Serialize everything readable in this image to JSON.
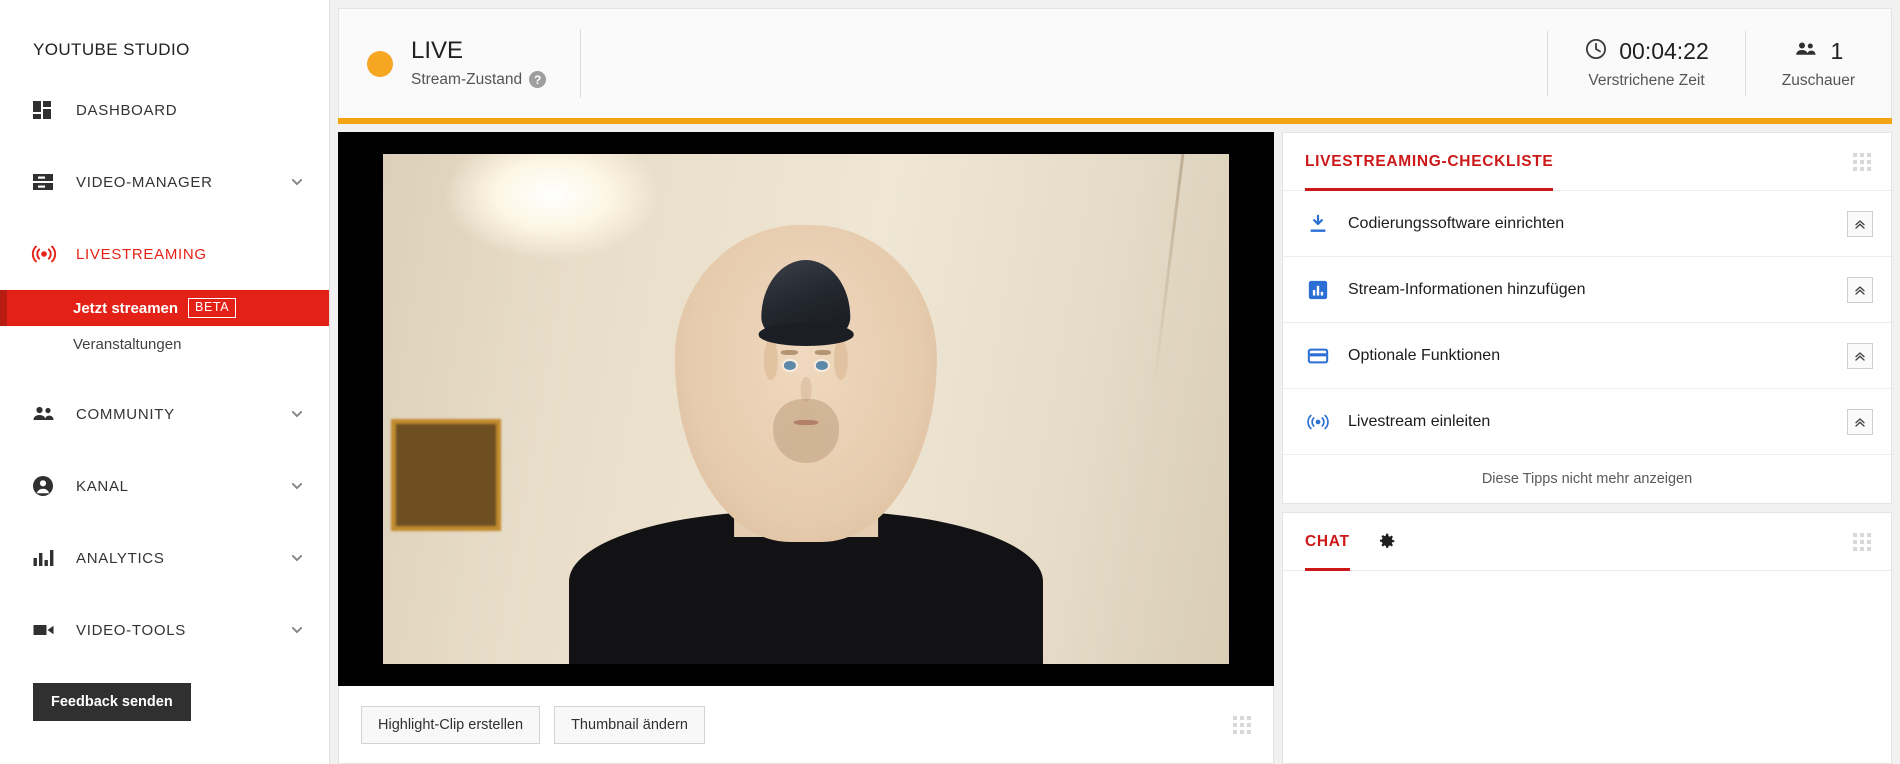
{
  "sidebar": {
    "brand": "YOUTUBE STUDIO",
    "items": [
      {
        "label": "DASHBOARD",
        "icon": "dashboard-icon",
        "expandable": false,
        "active": false
      },
      {
        "label": "VIDEO-MANAGER",
        "icon": "video-manager-icon",
        "expandable": true,
        "active": false
      },
      {
        "label": "LIVESTREAMING",
        "icon": "livestream-icon",
        "expandable": false,
        "active": true
      },
      {
        "label": "COMMUNITY",
        "icon": "community-icon",
        "expandable": true,
        "active": false
      },
      {
        "label": "KANAL",
        "icon": "channel-icon",
        "expandable": true,
        "active": false
      },
      {
        "label": "ANALYTICS",
        "icon": "analytics-icon",
        "expandable": true,
        "active": false
      },
      {
        "label": "VIDEO-TOOLS",
        "icon": "video-tools-icon",
        "expandable": true,
        "active": false
      }
    ],
    "sub_items": [
      {
        "label": "Jetzt streamen",
        "badge": "BETA",
        "selected": true
      },
      {
        "label": "Veranstaltungen",
        "badge": "",
        "selected": false
      }
    ],
    "feedback_button": "Feedback senden"
  },
  "header": {
    "status_title": "LIVE",
    "status_subtitle": "Stream-Zustand",
    "help_glyph": "?",
    "status_dot_color": "#f5a623",
    "accent_bar_color": "#f2a413",
    "metrics": [
      {
        "icon": "clock-icon",
        "value": "00:04:22",
        "label": "Verstrichene Zeit"
      },
      {
        "icon": "viewers-icon",
        "value": "1",
        "label": "Zuschauer"
      }
    ]
  },
  "player": {
    "scene": "webcam feed of a person wearing a dark cap and black v-neck shirt in a beige room with a ceiling light"
  },
  "action_bar": {
    "buttons": [
      {
        "label": "Highlight-Clip erstellen"
      },
      {
        "label": "Thumbnail ändern"
      }
    ],
    "drag_handle": "drag-handle-icon"
  },
  "checklist": {
    "title": "LIVESTREAMING-CHECKLISTE",
    "drag_handle": "drag-handle-icon",
    "items": [
      {
        "label": "Codierungssoftware einrichten",
        "icon": "download-icon",
        "collapse": "collapse-icon"
      },
      {
        "label": "Stream-Informationen hinzufügen",
        "icon": "bar-chart-icon",
        "collapse": "collapse-icon"
      },
      {
        "label": "Optionale Funktionen",
        "icon": "card-icon",
        "collapse": "collapse-icon"
      },
      {
        "label": "Livestream einleiten",
        "icon": "broadcast-icon",
        "collapse": "collapse-icon"
      }
    ],
    "dismiss_label": "Diese Tipps nicht mehr anzeigen"
  },
  "chat": {
    "title": "CHAT",
    "settings_icon": "gear-icon",
    "drag_handle": "drag-handle-icon"
  },
  "colors": {
    "brand_red": "#cc1818",
    "selected_red": "#e32117",
    "live_orange": "#f2a413",
    "icon_blue": "#2b6fd4"
  }
}
